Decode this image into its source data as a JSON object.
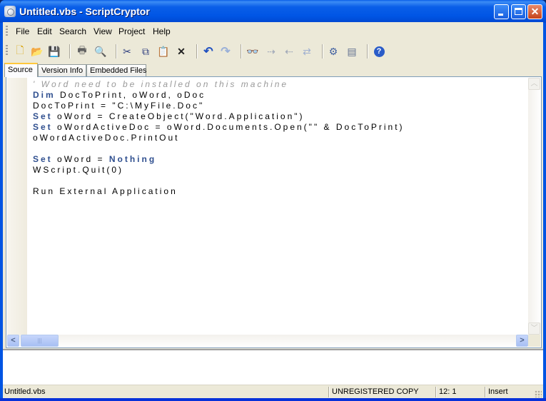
{
  "window": {
    "title": "Untitled.vbs - ScriptCryptor",
    "icon": "app-gear-icon",
    "controls": {
      "minimize": "minimize-icon",
      "maximize": "maximize-icon",
      "close": "close-icon",
      "close_glyph": "✕"
    }
  },
  "menubar": {
    "items": [
      {
        "label": "File"
      },
      {
        "label": "Edit"
      },
      {
        "label": "Search"
      },
      {
        "label": "View"
      },
      {
        "label": "Project"
      },
      {
        "label": "Help"
      }
    ]
  },
  "toolbar": {
    "buttons": [
      {
        "name": "new-file",
        "icon": "new-file-icon",
        "glyph": "🗋"
      },
      {
        "name": "open-file",
        "icon": "open-folder-icon",
        "glyph": "📂"
      },
      {
        "name": "save-file",
        "icon": "save-disk-icon",
        "glyph": "💾"
      },
      {
        "name": "print",
        "icon": "printer-icon",
        "glyph": "🖶"
      },
      {
        "name": "print-preview",
        "icon": "print-preview-icon",
        "glyph": "🔍"
      },
      {
        "name": "cut",
        "icon": "scissors-icon",
        "glyph": "✂"
      },
      {
        "name": "copy",
        "icon": "copy-icon",
        "glyph": "⧉"
      },
      {
        "name": "paste",
        "icon": "paste-icon",
        "glyph": "📋"
      },
      {
        "name": "delete",
        "icon": "delete-x-icon",
        "glyph": "✕"
      },
      {
        "name": "undo",
        "icon": "undo-icon",
        "glyph": "↶"
      },
      {
        "name": "redo",
        "icon": "redo-icon",
        "glyph": "↷"
      },
      {
        "name": "find",
        "icon": "binoculars-icon",
        "glyph": "👓"
      },
      {
        "name": "find-next",
        "icon": "find-next-icon",
        "glyph": "⇢"
      },
      {
        "name": "find-previous",
        "icon": "find-previous-icon",
        "glyph": "⇠"
      },
      {
        "name": "replace",
        "icon": "replace-ab-icon",
        "glyph": "⇄"
      },
      {
        "name": "build",
        "icon": "build-compile-icon",
        "glyph": "⚙"
      },
      {
        "name": "project-options",
        "icon": "project-options-icon",
        "glyph": "▤"
      },
      {
        "name": "help",
        "icon": "help-question-icon",
        "glyph": "?"
      }
    ]
  },
  "tabs": [
    {
      "label": "Source",
      "active": true
    },
    {
      "label": "Version Info",
      "active": false
    },
    {
      "label": "Embedded Files",
      "active": false
    }
  ],
  "editor": {
    "lines": [
      [
        {
          "t": "' Word need to be installed on this machine",
          "c": "comment"
        }
      ],
      [
        {
          "t": "Dim",
          "c": "kw"
        },
        {
          "t": " DocToPrint, oWord, oDoc",
          "c": ""
        }
      ],
      [
        {
          "t": "DocToPrint = \"C:\\MyFile.Doc\"",
          "c": ""
        }
      ],
      [
        {
          "t": "Set",
          "c": "kw"
        },
        {
          "t": " oWord = CreateObject(\"Word.Application\")",
          "c": ""
        }
      ],
      [
        {
          "t": "Set",
          "c": "kw"
        },
        {
          "t": " oWordActiveDoc = oWord.Documents.Open(\"\" & DocToPrint)",
          "c": ""
        }
      ],
      [
        {
          "t": "oWordActiveDoc.PrintOut",
          "c": ""
        }
      ],
      [
        {
          "t": "",
          "c": ""
        }
      ],
      [
        {
          "t": "Set",
          "c": "kw"
        },
        {
          "t": " oWord = ",
          "c": ""
        },
        {
          "t": "Nothing",
          "c": "kw"
        }
      ],
      [
        {
          "t": "WScript.Quit(0)",
          "c": ""
        }
      ],
      [
        {
          "t": "",
          "c": ""
        }
      ],
      [
        {
          "t": "Run External Application",
          "c": ""
        }
      ]
    ],
    "colors": {
      "keyword": "#2f4f8f",
      "comment": "#9a9a9a",
      "text": "#000000"
    },
    "scroll": {
      "up_glyph": "︿",
      "down_glyph": "﹀",
      "left_glyph": "<",
      "right_glyph": ">",
      "thumb_glyph": "|||"
    }
  },
  "output": {
    "text": ""
  },
  "statusbar": {
    "file": "Untitled.vbs",
    "registration": "UNREGISTERED COPY",
    "position": "12: 1",
    "mode": "Insert"
  }
}
